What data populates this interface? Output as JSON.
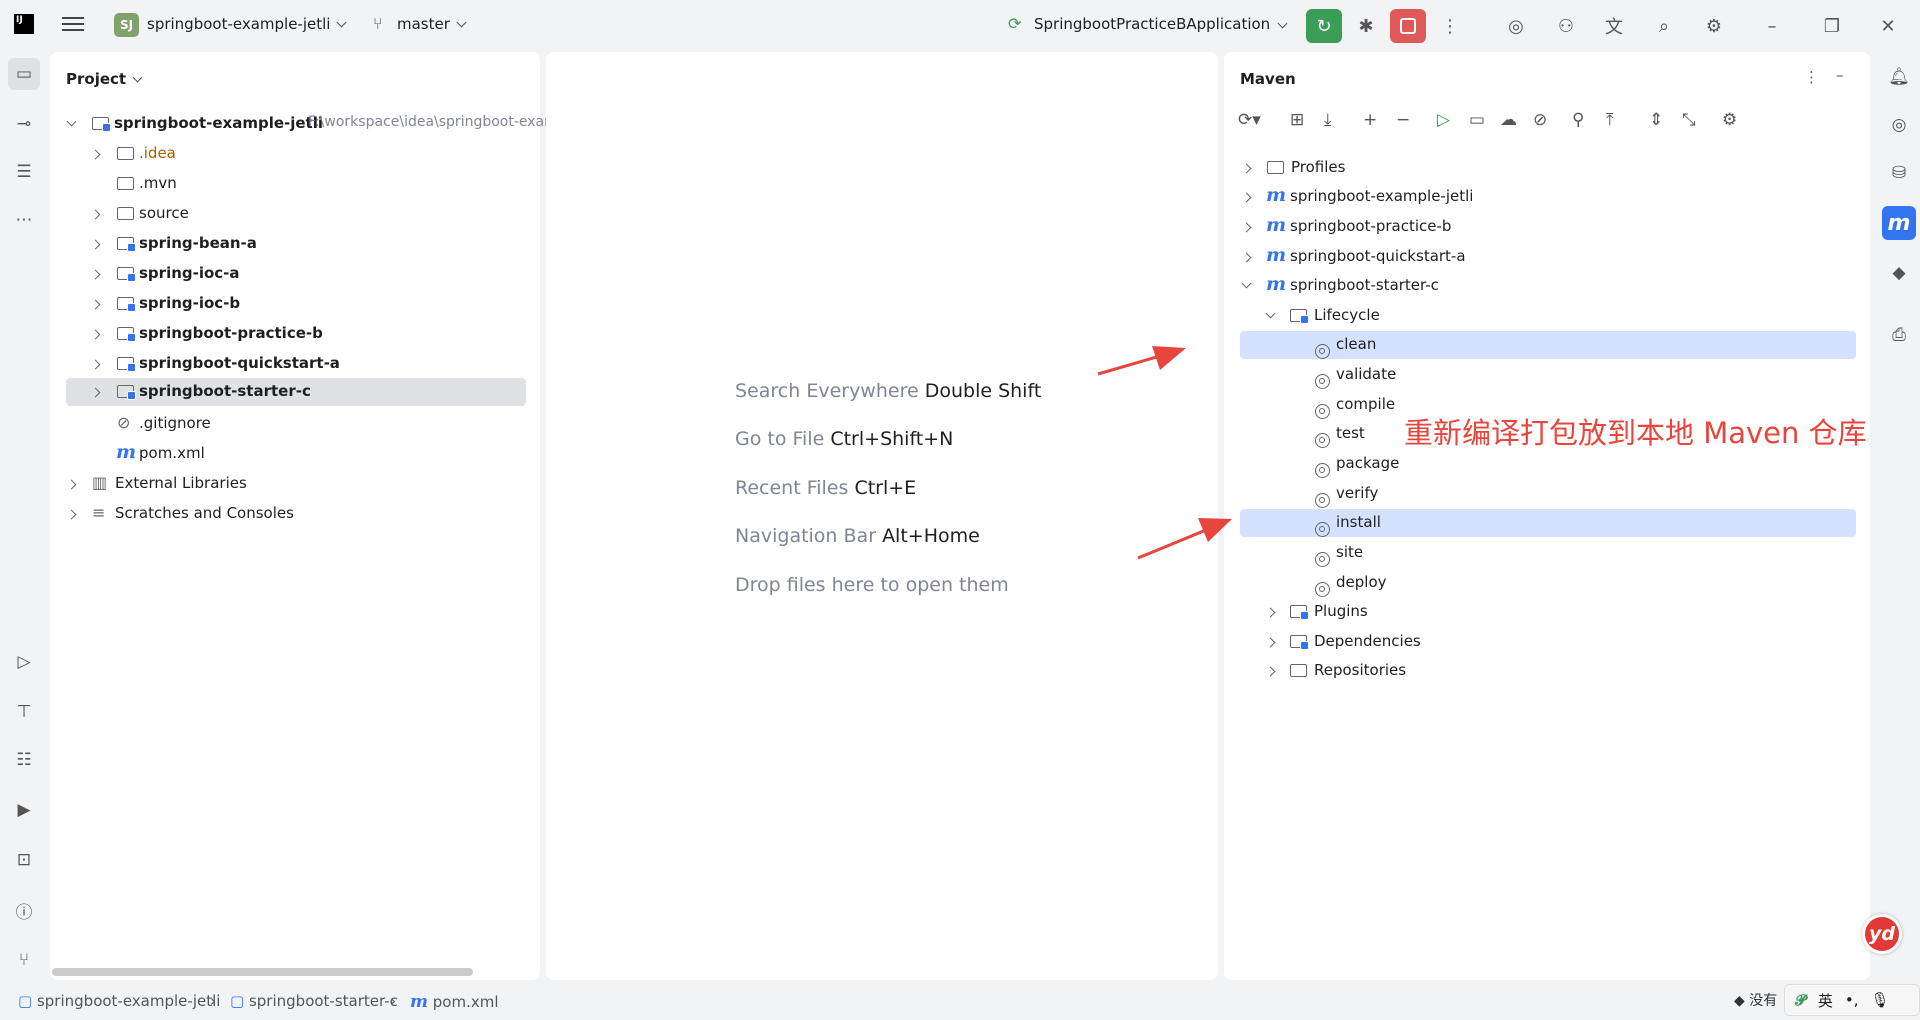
{
  "titlebar": {
    "logo_text": "IJ",
    "project_badge": "SJ",
    "project_name": "springboot-example-jetli",
    "branch": "master",
    "run_config": "SpringbootPracticeBApplication"
  },
  "project_panel": {
    "title": "Project",
    "root": {
      "name": "springboot-example-jetli",
      "path": "F:\\workspace\\idea\\springboot-exam"
    },
    "items": [
      {
        "label": ".idea",
        "style": "orange",
        "expandable": true
      },
      {
        "label": ".mvn",
        "style": "normal",
        "expandable": false
      },
      {
        "label": "source",
        "style": "normal",
        "expandable": true
      },
      {
        "label": "spring-bean-a",
        "style": "bold",
        "expandable": true
      },
      {
        "label": "spring-ioc-a",
        "style": "bold",
        "expandable": true
      },
      {
        "label": "spring-ioc-b",
        "style": "bold",
        "expandable": true
      },
      {
        "label": "springboot-practice-b",
        "style": "bold",
        "expandable": true
      },
      {
        "label": "springboot-quickstart-a",
        "style": "bold",
        "expandable": true
      },
      {
        "label": "springboot-starter-c",
        "style": "bold",
        "expandable": true,
        "selected": true
      },
      {
        "label": ".gitignore",
        "style": "normal",
        "expandable": false
      },
      {
        "label": "pom.xml",
        "style": "normal",
        "expandable": false
      }
    ],
    "external_libraries": "External Libraries",
    "scratches": "Scratches and Consoles"
  },
  "editor": {
    "hints": [
      {
        "label": "Search Everywhere",
        "shortcut": "Double Shift"
      },
      {
        "label": "Go to File",
        "shortcut": "Ctrl+Shift+N"
      },
      {
        "label": "Recent Files",
        "shortcut": "Ctrl+E"
      },
      {
        "label": "Navigation Bar",
        "shortcut": "Alt+Home"
      },
      {
        "label": "Drop files here to open them",
        "shortcut": ""
      }
    ]
  },
  "maven_panel": {
    "title": "Maven",
    "profiles": "Profiles",
    "modules": [
      "springboot-example-jetli",
      "springboot-practice-b",
      "springboot-quickstart-a",
      "springboot-starter-c"
    ],
    "lifecycle_label": "Lifecycle",
    "lifecycle": [
      "clean",
      "validate",
      "compile",
      "test",
      "package",
      "verify",
      "install",
      "site",
      "deploy"
    ],
    "plugins": "Plugins",
    "dependencies": "Dependencies",
    "repositories": "Repositories"
  },
  "annotation_text": "重新编译打包放到本地 Maven 仓库",
  "statusbar": {
    "crumbs": [
      "springboot-example-jetli",
      "springboot-starter-c",
      "pom.xml"
    ],
    "ime_lang": "英",
    "ime_extra": "没有"
  },
  "yd_logo": "yd",
  "colors": {
    "accent": "#3574f0",
    "annotation": "#e8453c",
    "run": "#3b9e57",
    "stop": "#e05959"
  }
}
